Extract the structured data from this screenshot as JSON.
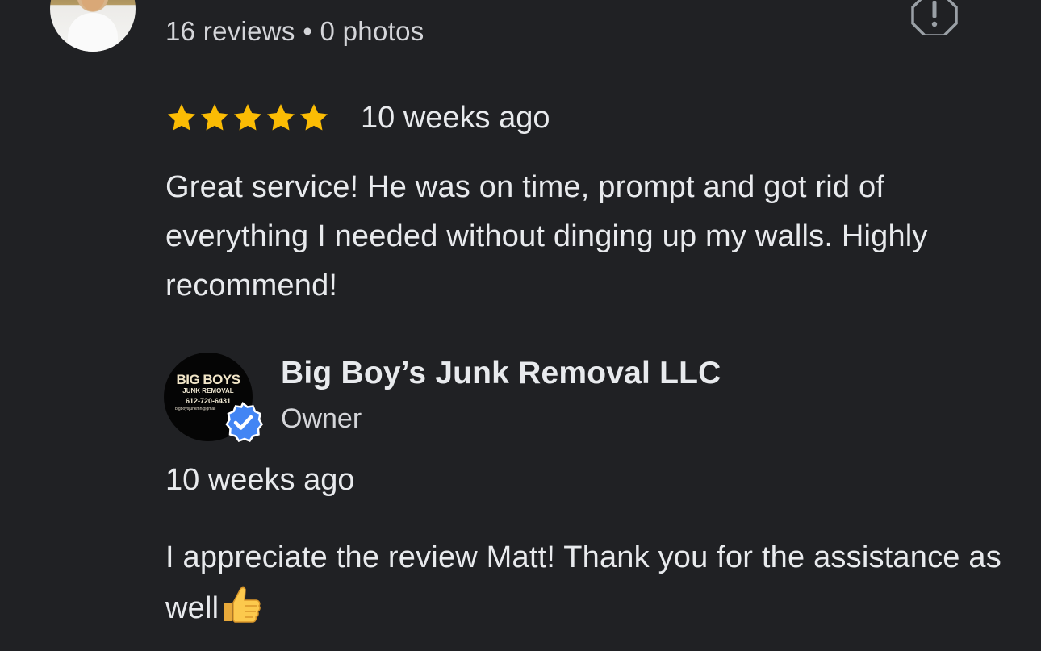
{
  "review": {
    "reviewer_meta": "16 reviews • 0 photos",
    "rating": 5,
    "rating_max": 5,
    "date": "10 weeks ago",
    "text": "Great service! He was on time, prompt and got rid of everything I needed without dinging up my walls. Highly recommend!"
  },
  "owner_reply": {
    "logo": {
      "title": "BIG BOYS",
      "subtitle": "JUNK REMOVAL",
      "phone": "612-720-6431",
      "email": "bigboysjunkmn@gmail"
    },
    "name": "Big Boy’s Junk Removal LLC",
    "role": "Owner",
    "date": "10 weeks ago",
    "text": "I appreciate the review Matt! Thank you for the assistance as well"
  },
  "icons": {
    "report": "report-flag-icon",
    "star": "star-icon",
    "verified": "verified-badge-icon",
    "thumbs_up": "thumbs-up-emoji"
  },
  "colors": {
    "background": "#202124",
    "star": "#fbbc04",
    "verified": "#4285f4",
    "text": "#e8eaed"
  }
}
